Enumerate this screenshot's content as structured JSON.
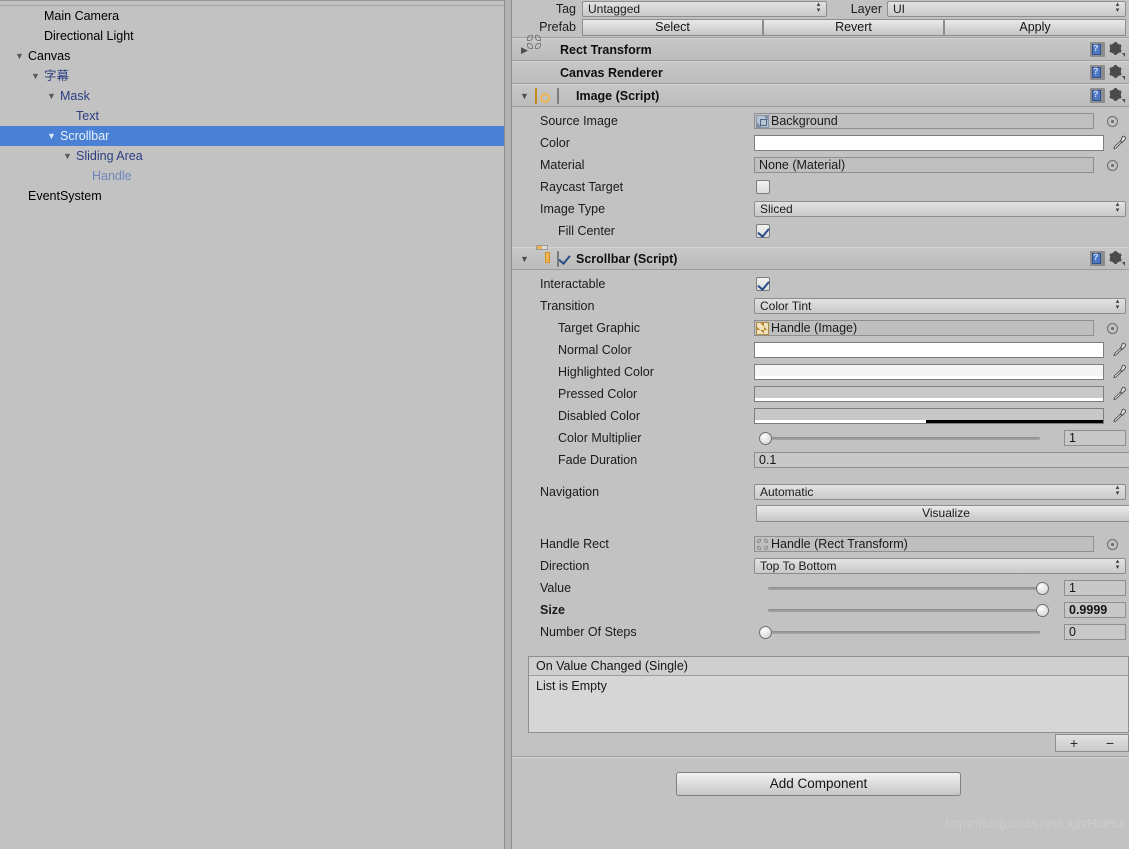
{
  "hierarchy": {
    "items": [
      {
        "label": "Main Camera",
        "depth": 1,
        "arrow": "",
        "style": "normal",
        "selected": false
      },
      {
        "label": "Directional Light",
        "depth": 1,
        "arrow": "",
        "style": "normal",
        "selected": false
      },
      {
        "label": "Canvas",
        "depth": 0,
        "arrow": "▼",
        "style": "normal",
        "selected": false
      },
      {
        "label": "字幕",
        "depth": 1,
        "arrow": "▼",
        "style": "blue",
        "selected": false
      },
      {
        "label": "Mask",
        "depth": 2,
        "arrow": "▼",
        "style": "blue",
        "selected": false
      },
      {
        "label": "Text",
        "depth": 3,
        "arrow": "",
        "style": "blue",
        "selected": false
      },
      {
        "label": "Scrollbar",
        "depth": 2,
        "arrow": "▼",
        "style": "selected",
        "selected": true
      },
      {
        "label": "Sliding Area",
        "depth": 3,
        "arrow": "▼",
        "style": "blue",
        "selected": false
      },
      {
        "label": "Handle",
        "depth": 4,
        "arrow": "",
        "style": "lightblue",
        "selected": false
      },
      {
        "label": "EventSystem",
        "depth": 0,
        "arrow": "",
        "style": "normal",
        "selected": false
      }
    ]
  },
  "inspector": {
    "tag_label": "Tag",
    "tag_value": "Untagged",
    "layer_label": "Layer",
    "layer_value": "UI",
    "prefab_label": "Prefab",
    "prefab_buttons": [
      "Select",
      "Revert",
      "Apply"
    ],
    "components": {
      "rect_transform": {
        "title": "Rect Transform",
        "icon": "rect-transform-icon"
      },
      "canvas_renderer": {
        "title": "Canvas Renderer",
        "icon": "canvas-renderer-icon"
      },
      "image": {
        "title": "Image (Script)",
        "icon": "image-sprite-icon",
        "enabled": false,
        "rows": {
          "source_image_label": "Source Image",
          "source_image_value": "Background",
          "color_label": "Color",
          "color_value": "#FFFFFF",
          "material_label": "Material",
          "material_value": "None (Material)",
          "raycast_label": "Raycast Target",
          "raycast_checked": false,
          "image_type_label": "Image Type",
          "image_type_value": "Sliced",
          "fill_center_label": "Fill Center",
          "fill_center_checked": true
        }
      },
      "scrollbar": {
        "title": "Scrollbar (Script)",
        "icon": "scrollbar-icon",
        "enabled": true,
        "rows": {
          "interactable_label": "Interactable",
          "interactable_checked": true,
          "transition_label": "Transition",
          "transition_value": "Color Tint",
          "target_graphic_label": "Target Graphic",
          "target_graphic_value": "Handle (Image)",
          "normal_color_label": "Normal Color",
          "normal_color_value": "#FFFFFF",
          "highlighted_color_label": "Highlighted Color",
          "highlighted_color_value": "#F5F5F5",
          "pressed_color_label": "Pressed Color",
          "pressed_color_value": "#C8C8C8",
          "disabled_color_label": "Disabled Color",
          "disabled_color_value": "#C8C8C8",
          "color_multiplier_label": "Color Multiplier",
          "color_multiplier_value": "1",
          "fade_duration_label": "Fade Duration",
          "fade_duration_value": "0.1",
          "navigation_label": "Navigation",
          "navigation_value": "Automatic",
          "visualize_label": "Visualize",
          "handle_rect_label": "Handle Rect",
          "handle_rect_value": "Handle (Rect Transform)",
          "direction_label": "Direction",
          "direction_value": "Top To Bottom",
          "value_label": "Value",
          "value_value": "1",
          "size_label": "Size",
          "size_value": "0.9999",
          "steps_label": "Number Of Steps",
          "steps_value": "0"
        },
        "event": {
          "header": "On Value Changed (Single)",
          "empty_text": "List is Empty",
          "add_label": "+",
          "remove_label": "−"
        }
      }
    },
    "add_component_label": "Add Component"
  },
  "watermark": "https://blog.csdn.net/LightHuiHui"
}
